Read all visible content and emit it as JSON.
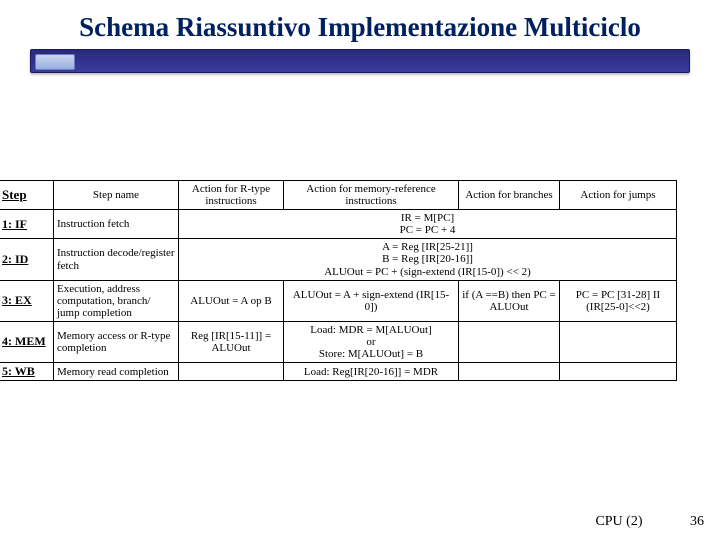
{
  "title": "Schema Riassuntivo Implementazione Multiciclo",
  "headers": {
    "step": "Step",
    "stepname": "Step name",
    "rtype": "Action for R-type instructions",
    "memref": "Action for memory-reference instructions",
    "branch": "Action for branches",
    "jump": "Action for jumps"
  },
  "rows": {
    "r1": {
      "step": "1: IF",
      "name": "Instruction fetch",
      "merged": "IR = M[PC]\nPC = PC + 4"
    },
    "r2": {
      "step": "2: ID",
      "name": "Instruction decode/register fetch",
      "merged": "A = Reg [IR[25-21]]\nB = Reg [IR[20-16]]\nALUOut = PC + (sign-extend (IR[15-0]) << 2)"
    },
    "r3": {
      "step": "3: EX",
      "name": "Execution, address computation, branch/ jump completion",
      "rtype": "ALUOut = A op B",
      "memref": "ALUOut = A + sign-extend (IR[15-0])",
      "branch": "if (A ==B) then PC = ALUOut",
      "jump": "PC = PC [31-28] II (IR[25-0]<<2)"
    },
    "r4": {
      "step": "4: MEM",
      "name": "Memory access or R-type completion",
      "rtype": "Reg [IR[15-11]] = ALUOut",
      "memref": "Load: MDR = M[ALUOut]\nor\nStore: M[ALUOut] = B"
    },
    "r5": {
      "step": "5: WB",
      "name": "Memory read completion",
      "memref": "Load: Reg[IR[20-16]] = MDR"
    }
  },
  "footer": {
    "label": "CPU (2)",
    "page": "36"
  }
}
